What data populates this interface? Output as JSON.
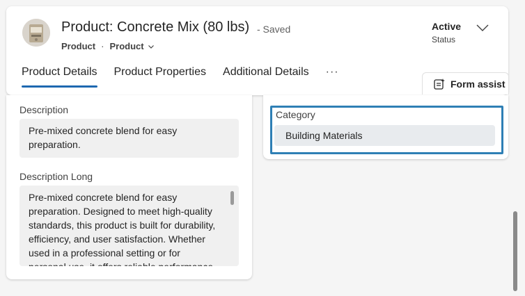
{
  "header": {
    "title": "Product: Concrete Mix (80 lbs)",
    "saved_state": "- Saved",
    "breadcrumb": {
      "entity": "Product",
      "separator": "·",
      "form": "Product"
    },
    "status": {
      "value": "Active",
      "label": "Status"
    },
    "avatar_icon": "product-image"
  },
  "tabs": [
    {
      "label": "Product Details",
      "active": true
    },
    {
      "label": "Product Properties",
      "active": false
    },
    {
      "label": "Additional Details",
      "active": false
    }
  ],
  "more_label": "···",
  "form_assist": {
    "label": "Form assist",
    "icon": "form-assist-icon"
  },
  "fields": {
    "description": {
      "label": "Description",
      "value": "Pre-mixed concrete blend for easy preparation."
    },
    "description_long": {
      "label": "Description Long",
      "value": "Pre-mixed concrete blend for easy preparation. Designed to meet high-quality standards, this product is built for durability, efficiency, and user satisfaction. Whether used in a professional setting or for personal use, it offers reliable performance."
    },
    "category": {
      "label": "Category",
      "value": "Building Materials"
    }
  },
  "colors": {
    "accent": "#1e68b0",
    "highlight_border": "#2e7fb5"
  }
}
